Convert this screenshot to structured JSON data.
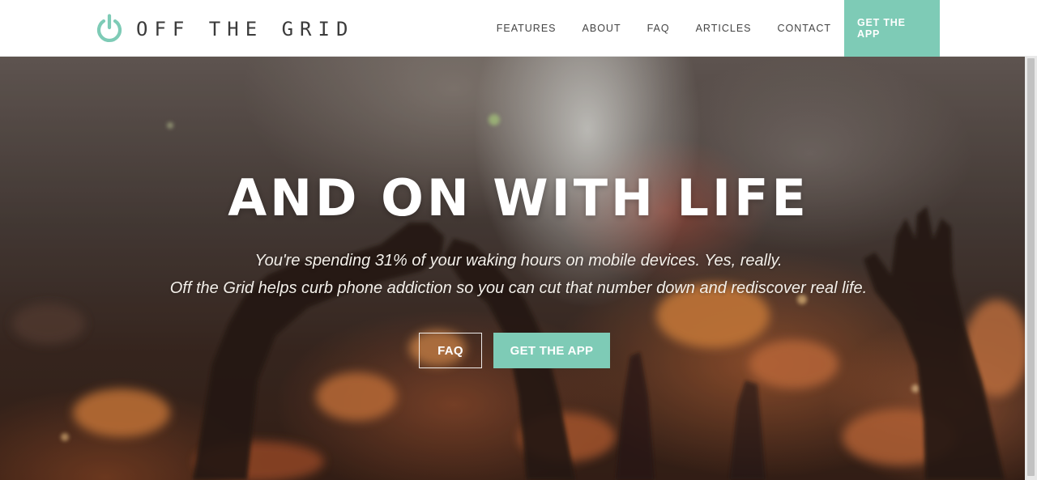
{
  "brand": {
    "name": "OFF THE GRID",
    "logo_icon": "power-icon",
    "accent_color": "#7ecbb6"
  },
  "nav": {
    "items": [
      {
        "label": "FEATURES"
      },
      {
        "label": "ABOUT"
      },
      {
        "label": "FAQ"
      },
      {
        "label": "ARTICLES"
      },
      {
        "label": "CONTACT"
      }
    ],
    "cta_label": "GET THE APP"
  },
  "hero": {
    "title": "AND ON WITH LIFE",
    "subtitle_line1": "You're spending 31% of your waking hours on mobile devices. Yes, really.",
    "subtitle_line2": "Off the Grid helps curb phone addiction so you can cut that number down and rediscover real life.",
    "button_secondary": "FAQ",
    "button_primary": "GET THE APP",
    "background_image": "concert crowd with raised hands"
  }
}
